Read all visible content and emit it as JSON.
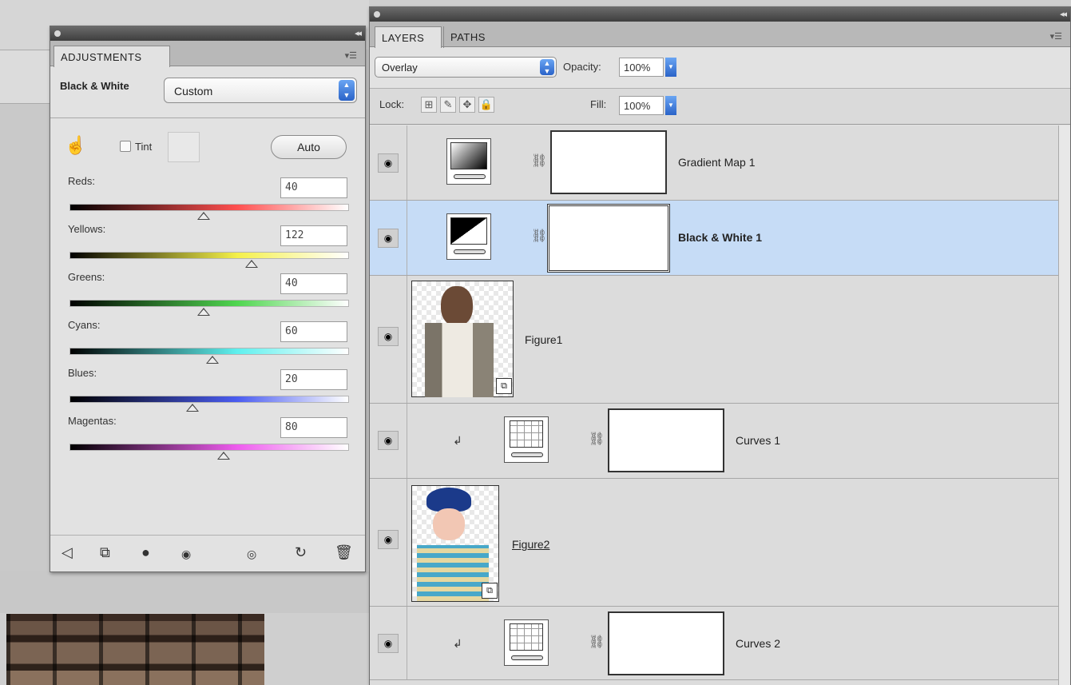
{
  "adjustments": {
    "tab": "ADJUSTMENTS",
    "menu": "▾☰",
    "type_label": "Black & White",
    "preset": "Custom",
    "tint_label": "Tint",
    "auto_label": "Auto",
    "sliders": [
      {
        "label": "Reds:",
        "value": "40",
        "level": 0.48
      },
      {
        "label": "Yellows:",
        "value": "122",
        "level": 0.65
      },
      {
        "label": "Greens:",
        "value": "40",
        "level": 0.48
      },
      {
        "label": "Cyans:",
        "value": "60",
        "level": 0.51
      },
      {
        "label": "Blues:",
        "value": "20",
        "level": 0.44
      },
      {
        "label": "Magentas:",
        "value": "80",
        "level": 0.55
      }
    ],
    "track_colors": [
      [
        "#000000",
        "#ff5050"
      ],
      [
        "#000000",
        "#f4f04a"
      ],
      [
        "#000000",
        "#4fd64f"
      ],
      [
        "#000000",
        "#5ff0ee"
      ],
      [
        "#000000",
        "#4a5cf0"
      ],
      [
        "#000000",
        "#ee5cee"
      ]
    ],
    "footer_icons": [
      "back-arrow-icon",
      "clip-to-layer-icon",
      "mask-visibility-icon",
      "eye-icon",
      "view-previous-icon",
      "reset-icon",
      "delete-icon"
    ]
  },
  "layers": {
    "tabs": [
      "LAYERS",
      "PATHS"
    ],
    "menu": "▾☰",
    "blend_mode": "Overlay",
    "opacity_label": "Opacity:",
    "opacity": "100%",
    "lock_label": "Lock:",
    "fill_label": "Fill:",
    "fill": "100%",
    "items": [
      {
        "name": "Gradient Map 1"
      },
      {
        "name": "Black & White 1"
      },
      {
        "name": "Figure1"
      },
      {
        "name": "Curves 1"
      },
      {
        "name": "Figure2"
      },
      {
        "name": "Curves 2"
      }
    ]
  }
}
